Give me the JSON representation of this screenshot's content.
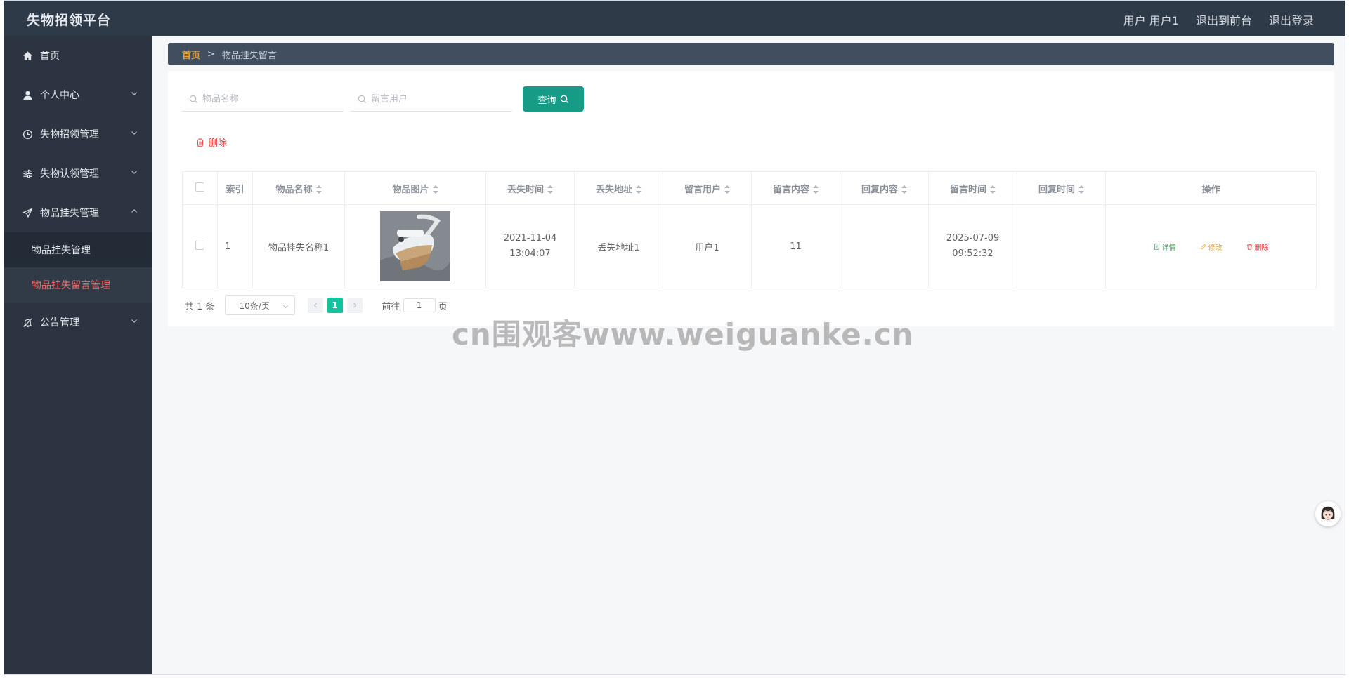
{
  "header": {
    "title": "失物招领平台",
    "user_label": "用户 用户1",
    "to_front": "退出到前台",
    "logout": "退出登录"
  },
  "sidebar": {
    "items": [
      {
        "label": "首页",
        "icon": "home-icon"
      },
      {
        "label": "个人中心",
        "icon": "user-icon"
      },
      {
        "label": "失物招领管理",
        "icon": "clock-icon"
      },
      {
        "label": "失物认领管理",
        "icon": "sliders-icon"
      },
      {
        "label": "物品挂失管理",
        "icon": "send-icon",
        "expanded": true,
        "children": [
          {
            "label": "物品挂失管理"
          },
          {
            "label": "物品挂失留言管理",
            "active": true
          }
        ]
      },
      {
        "label": "公告管理",
        "icon": "bell-off-icon"
      }
    ]
  },
  "breadcrumb": {
    "home": "首页",
    "separator": ">",
    "current": "物品挂失留言"
  },
  "search": {
    "item_name_placeholder": "物品名称",
    "user_placeholder": "留言用户",
    "query_label": "查询"
  },
  "toolbar": {
    "delete_label": "删除"
  },
  "table": {
    "columns": [
      "索引",
      "物品名称",
      "物品图片",
      "丢失时间",
      "丢失地址",
      "留言用户",
      "留言内容",
      "回复内容",
      "留言时间",
      "回复时间",
      "操作"
    ],
    "rows": [
      {
        "index": "1",
        "item_name": "物品挂失名称1",
        "lost_time": "2021-11-04 13:04:07",
        "lost_address": "丢失地址1",
        "user": "用户1",
        "content": "11",
        "reply": "",
        "message_time": "2025-07-09 09:52:32",
        "reply_time": "",
        "actions": {
          "detail": "详情",
          "edit": "修改",
          "delete": "删除"
        }
      }
    ]
  },
  "pagination": {
    "total_text": "共 1 条",
    "page_size": "10条/页",
    "current_page": "1",
    "goto_prefix": "前往",
    "goto_value": "1",
    "goto_suffix": "页"
  },
  "watermark": "cn围观客www.weiguanke.cn",
  "colors": {
    "header_bg": "#2f3a49",
    "sidebar_bg": "#2b3440",
    "active_menu_text": "#f56c6c",
    "primary": "#169b86",
    "page_active": "#13c39d",
    "danger": "#e53b3b",
    "warning": "#e9a631",
    "success": "#3aa854"
  }
}
